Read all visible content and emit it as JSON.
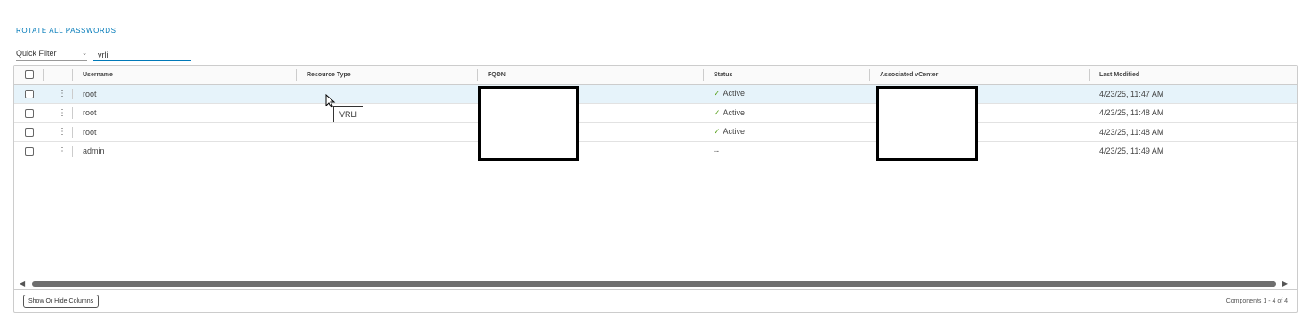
{
  "actions": {
    "rotate_all": "ROTATE ALL PASSWORDS"
  },
  "filter": {
    "label": "Quick Filter",
    "value": "vrli"
  },
  "columns": [
    "Username",
    "Resource Type",
    "FQDN",
    "Status",
    "Associated vCenter",
    "Last Modified"
  ],
  "rows": [
    {
      "username": "root",
      "resource_type": "",
      "fqdn": "",
      "status": "Active",
      "status_ok": true,
      "vcenter": "",
      "last_modified": "4/23/25, 11:47 AM"
    },
    {
      "username": "root",
      "resource_type": "",
      "fqdn": "",
      "status": "Active",
      "status_ok": true,
      "vcenter": "",
      "last_modified": "4/23/25, 11:48 AM"
    },
    {
      "username": "root",
      "resource_type": "",
      "fqdn": "",
      "status": "Active",
      "status_ok": true,
      "vcenter": "",
      "last_modified": "4/23/25, 11:48 AM"
    },
    {
      "username": "admin",
      "resource_type": "",
      "fqdn": "",
      "status": "--",
      "status_ok": false,
      "vcenter": "",
      "last_modified": "4/23/25, 11:49 AM"
    }
  ],
  "tooltip": "VRLI",
  "footer": {
    "columns_button": "Show Or Hide Columns",
    "pagination": "Components 1 - 4 of 4"
  },
  "icons": {
    "check": "check-icon",
    "menu": "vertical-ellipsis-icon",
    "chevron": "chevron-down-icon"
  },
  "colors": {
    "accent": "#0079b8",
    "selected_row": "#e6f3fa",
    "active": "#5aa220"
  }
}
